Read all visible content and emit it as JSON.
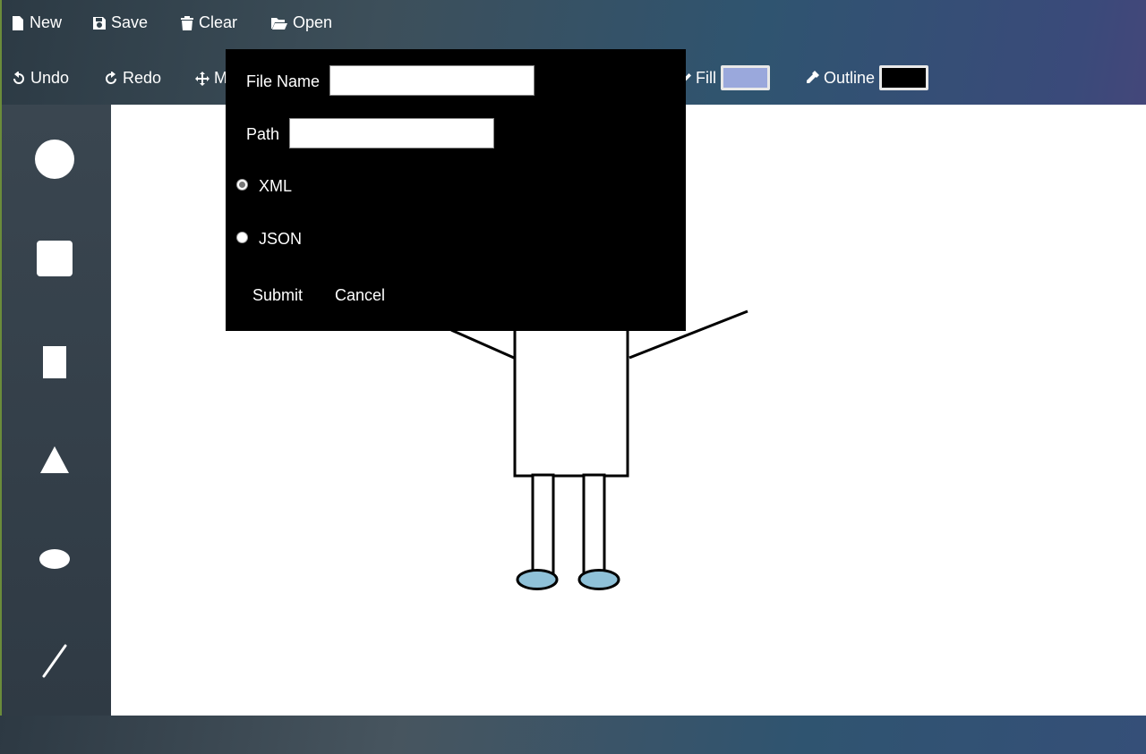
{
  "toolbar": {
    "new_label": "New",
    "save_label": "Save",
    "clear_label": "Clear",
    "open_label": "Open",
    "undo_label": "Undo",
    "redo_label": "Redo",
    "move_label_visible": "M",
    "fill_label": "Fill",
    "outline_label": "Outline",
    "fill_color": "#9aa8dc",
    "outline_color": "#000000"
  },
  "sidebar": {
    "tools": [
      {
        "name": "circle",
        "icon": "circle-icon"
      },
      {
        "name": "square",
        "icon": "square-icon"
      },
      {
        "name": "rectangle",
        "icon": "rectangle-icon"
      },
      {
        "name": "triangle",
        "icon": "triangle-icon"
      },
      {
        "name": "ellipse",
        "icon": "ellipse-icon"
      },
      {
        "name": "line",
        "icon": "line-icon"
      }
    ]
  },
  "dialog": {
    "file_name_label": "File Name",
    "file_name_value": "",
    "path_label": "Path",
    "path_value": "",
    "format_options": [
      {
        "label": "XML",
        "selected": true
      },
      {
        "label": "JSON",
        "selected": false
      }
    ],
    "submit_label": "Submit",
    "cancel_label": "Cancel"
  },
  "drawing": {
    "shoe_color": "#8fc1d8",
    "stroke_color": "#000000"
  }
}
